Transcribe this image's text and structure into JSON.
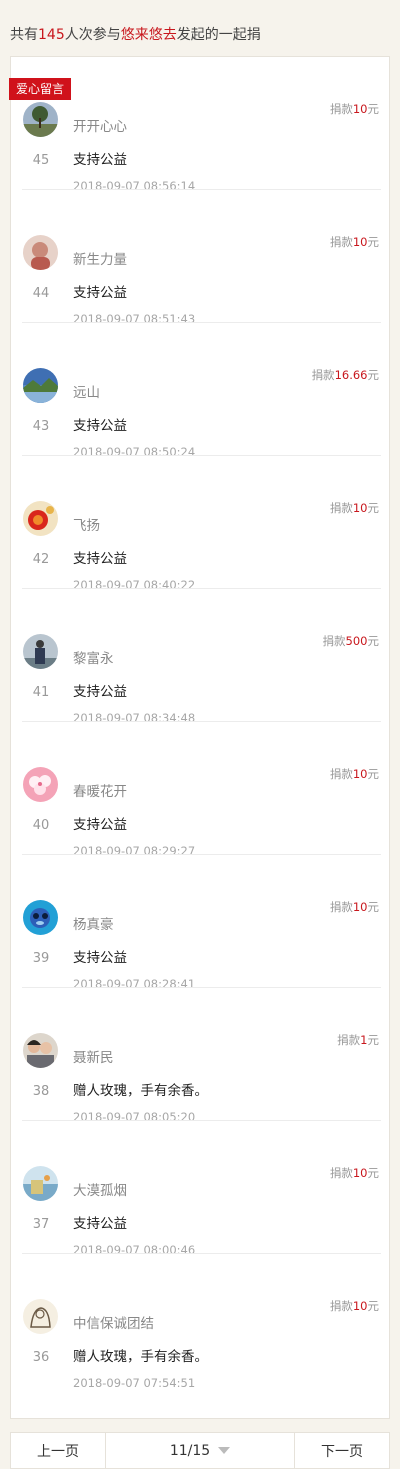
{
  "header": {
    "prefix": "共有",
    "count": "145",
    "mid": "人次参与",
    "initiator": "悠来悠去",
    "suffix": "发起的一起捐"
  },
  "tag_label": "爱心留言",
  "amount_prefix": "捐款",
  "amount_suffix": "元",
  "entries": [
    {
      "num": "45",
      "name": "开开心心",
      "message": "支持公益",
      "time": "2018-09-07 08:56:14",
      "amount": "10",
      "avatar_icon": "tree-landscape-avatar-icon"
    },
    {
      "num": "44",
      "name": "新生力量",
      "message": "支持公益",
      "time": "2018-09-07 08:51:43",
      "amount": "10",
      "avatar_icon": "child-portrait-avatar-icon"
    },
    {
      "num": "43",
      "name": "远山",
      "message": "支持公益",
      "time": "2018-09-07 08:50:24",
      "amount": "16.66",
      "avatar_icon": "lake-mountain-avatar-icon"
    },
    {
      "num": "42",
      "name": "飞扬",
      "message": "支持公益",
      "time": "2018-09-07 08:40:22",
      "amount": "10",
      "avatar_icon": "red-flower-avatar-icon"
    },
    {
      "num": "41",
      "name": "黎富永",
      "message": "支持公益",
      "time": "2018-09-07 08:34:48",
      "amount": "500",
      "avatar_icon": "person-standing-avatar-icon"
    },
    {
      "num": "40",
      "name": "春暖花开",
      "message": "支持公益",
      "time": "2018-09-07 08:29:27",
      "amount": "10",
      "avatar_icon": "pink-blossom-avatar-icon"
    },
    {
      "num": "39",
      "name": "杨真豪",
      "message": "支持公益",
      "time": "2018-09-07 08:28:41",
      "amount": "10",
      "avatar_icon": "blue-cartoon-avatar-icon"
    },
    {
      "num": "38",
      "name": "聂新民",
      "message": "赠人玫瑰，手有余香。",
      "time": "2018-09-07 08:05:20",
      "amount": "1",
      "avatar_icon": "couple-photo-avatar-icon"
    },
    {
      "num": "37",
      "name": "大漠孤烟",
      "message": "支持公益",
      "time": "2018-09-07 08:00:46",
      "amount": "10",
      "avatar_icon": "painting-avatar-icon"
    },
    {
      "num": "36",
      "name": "中信保诚团结",
      "message": "赠人玫瑰，手有余香。",
      "time": "2018-09-07 07:54:51",
      "amount": "10",
      "avatar_icon": "sketch-avatar-icon"
    }
  ],
  "pager": {
    "prev": "上一页",
    "page": "11/15",
    "next": "下一页"
  },
  "colors": {
    "accent_red": "#c8171d",
    "tag_red": "#d0121b",
    "page_bg": "#f6f3ec"
  }
}
